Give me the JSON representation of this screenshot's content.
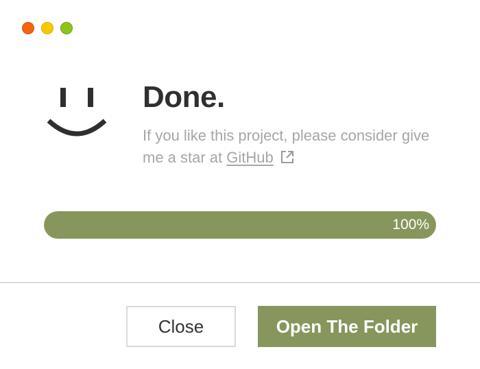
{
  "window": {
    "controls": [
      "close",
      "minimize",
      "zoom"
    ]
  },
  "status": {
    "icon": "smiley-face-icon",
    "title": "Done.",
    "message_part1": "If you like this project, please consider give me a star at",
    "link_text": "GitHub",
    "link_icon": "external-link-icon"
  },
  "progress": {
    "value": 100,
    "label": "100%"
  },
  "buttons": {
    "close_label": "Close",
    "open_label": "Open The Folder"
  },
  "colors": {
    "accent": "#86965c",
    "title_text": "#2f2f2f",
    "muted_text": "#a6a6a6",
    "traffic_close": "#f4640e",
    "traffic_minimize": "#f7c900",
    "traffic_zoom": "#8ec31b"
  }
}
